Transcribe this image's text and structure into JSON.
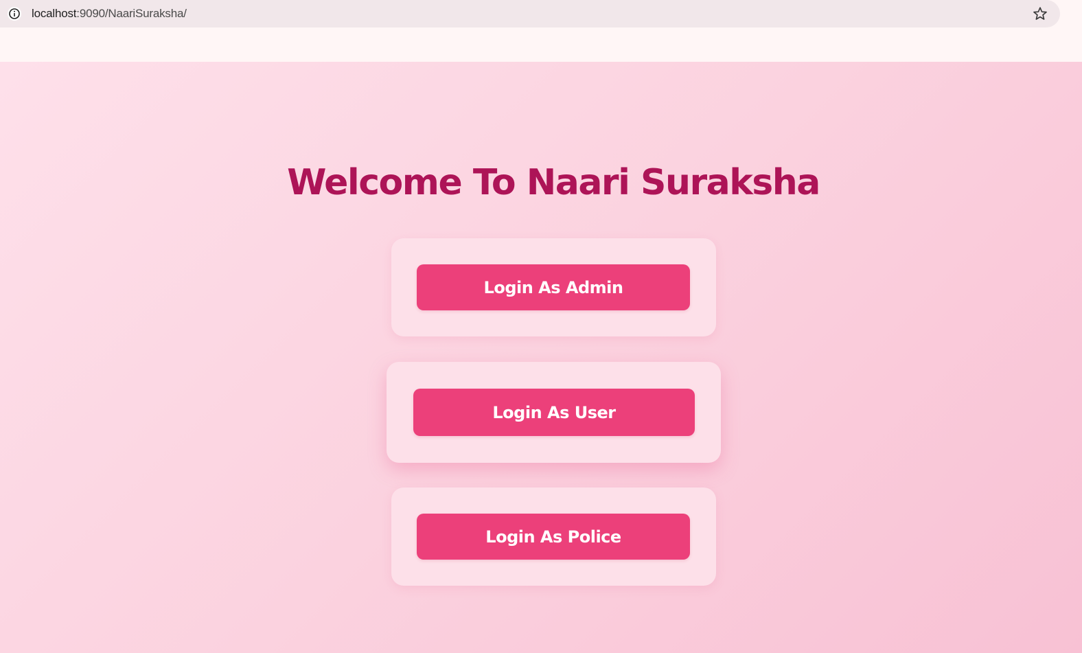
{
  "browser": {
    "url_host": "localhost",
    "url_path": ":9090/NaariSuraksha/"
  },
  "page": {
    "title": "Welcome To Naari Suraksha"
  },
  "buttons": {
    "admin": "Login As Admin",
    "user": "Login As User",
    "police": "Login As Police"
  },
  "colors": {
    "title": "#ad1457",
    "button": "#ec407a",
    "card": "#fde0e9"
  }
}
